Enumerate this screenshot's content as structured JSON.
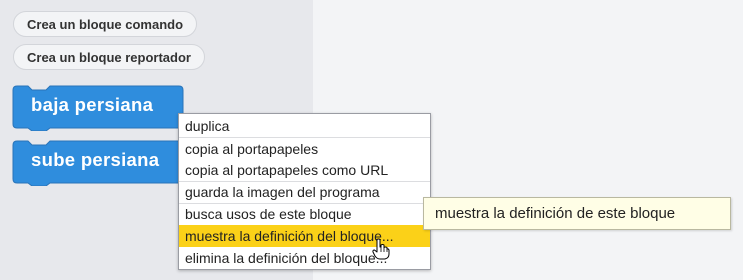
{
  "palette": {
    "make_command_label": "Crea un bloque comando",
    "make_reporter_label": "Crea un bloque reportador"
  },
  "blocks": [
    {
      "label": "baja persiana"
    },
    {
      "label": "sube persiana"
    }
  ],
  "context_menu": {
    "items": [
      {
        "label": "duplica"
      },
      {
        "label": "copia al portapapeles"
      },
      {
        "label": "copia al portapapeles como URL"
      },
      {
        "label": "guarda la imagen del programa"
      },
      {
        "label": "busca usos de este bloque"
      },
      {
        "label": "muestra la definición del bloque..."
      },
      {
        "label": "elimina la definición del bloque..."
      }
    ]
  },
  "tooltip": {
    "text": "muestra la definición de este bloque"
  },
  "colors": {
    "block": "#2f8ddd",
    "block_border": "#2a74b9",
    "menu_highlight": "#fbd118",
    "tooltip_bg": "#fffee6"
  },
  "icons": {
    "cursor": "hand-pointer-icon"
  }
}
